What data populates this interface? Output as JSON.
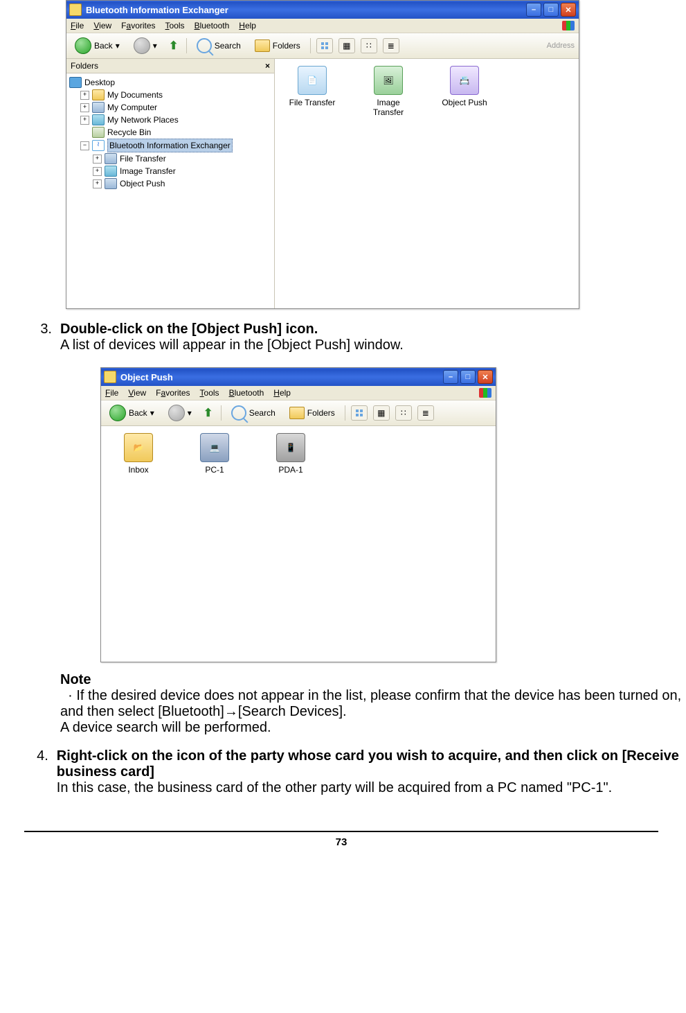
{
  "window1": {
    "title": "Bluetooth Information Exchanger",
    "menus": [
      "File",
      "View",
      "Favorites",
      "Tools",
      "Bluetooth",
      "Help"
    ],
    "menu_accel": [
      "F",
      "V",
      "a",
      "T",
      "B",
      "H"
    ],
    "toolbar": {
      "back": "Back",
      "search": "Search",
      "folders": "Folders",
      "address": "Address"
    },
    "folders_label": "Folders",
    "tree": {
      "desktop": "Desktop",
      "mydocs": "My Documents",
      "mycomp": "My Computer",
      "mynet": "My Network Places",
      "recycle": "Recycle Bin",
      "bt": "Bluetooth Information Exchanger",
      "ft": "File Transfer",
      "it": "Image Transfer",
      "op": "Object Push"
    },
    "content": {
      "file_transfer": "File Transfer",
      "image_transfer": "Image\nTransfer",
      "object_push": "Object Push"
    }
  },
  "step3": {
    "num": "3.",
    "title": "Double-click on the [Object Push] icon.",
    "body": "A list of devices will appear in the [Object Push] window."
  },
  "window2": {
    "title": "Object Push",
    "menus": [
      "File",
      "View",
      "Favorites",
      "Tools",
      "Bluetooth",
      "Help"
    ],
    "toolbar": {
      "back": "Back",
      "search": "Search",
      "folders": "Folders"
    },
    "items": {
      "inbox": "Inbox",
      "pc1": "PC-1",
      "pda1": "PDA-1"
    }
  },
  "note": {
    "label": "Note",
    "body": "If the desired device does not appear in the list, please confirm that the device has been turned on, and then select [Bluetooth]→[Search Devices].",
    "body2": "A device search will be performed."
  },
  "step4": {
    "num": "4.",
    "title": "Right-click on the icon of the party whose card you wish to acquire, and then click on [Receive business card]",
    "body": "In this case, the business card of the other party will be acquired from a PC named \"PC-1\"."
  },
  "page_number": "73"
}
